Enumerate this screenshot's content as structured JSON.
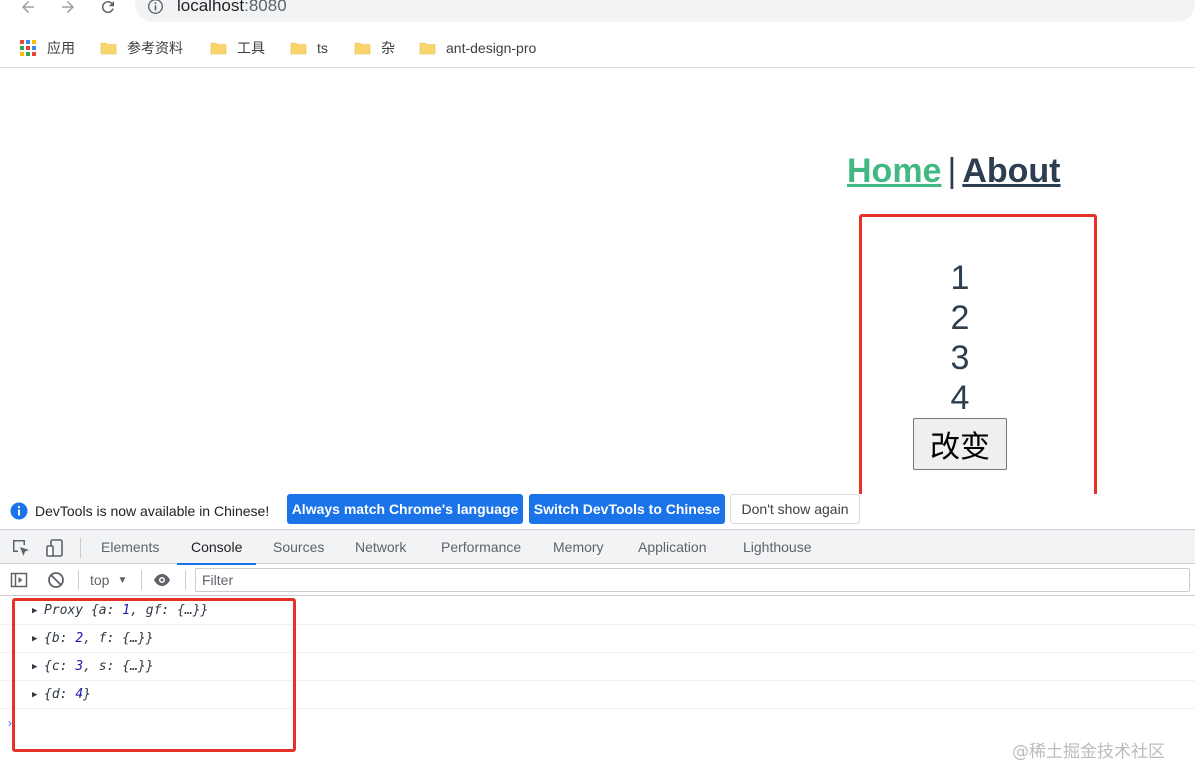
{
  "browser": {
    "url_host": "localhost",
    "url_port": ":8080",
    "bookmarks": [
      {
        "label": "应用"
      },
      {
        "label": "参考资料"
      },
      {
        "label": "工具"
      },
      {
        "label": "ts"
      },
      {
        "label": "杂"
      },
      {
        "label": "ant-design-pro"
      }
    ]
  },
  "page": {
    "nav": {
      "home": "Home",
      "separator": "|",
      "about": "About"
    },
    "numbers": [
      "1",
      "2",
      "3",
      "4"
    ],
    "change_button": "改变"
  },
  "devtools": {
    "infobar": {
      "message": "DevTools is now available in Chinese!",
      "btn_match": "Always match Chrome's language",
      "btn_switch": "Switch DevTools to Chinese",
      "btn_dismiss": "Don't show again"
    },
    "tabs": [
      "Elements",
      "Console",
      "Sources",
      "Network",
      "Performance",
      "Memory",
      "Application",
      "Lighthouse"
    ],
    "active_tab": "Console",
    "console": {
      "context": "top",
      "filter_placeholder": "Filter",
      "lines": [
        {
          "prefix": "Proxy {a: ",
          "num": "1",
          "suffix": ", gf: {…}}"
        },
        {
          "prefix": "{b: ",
          "num": "2",
          "suffix": ", f: {…}}"
        },
        {
          "prefix": "{c: ",
          "num": "3",
          "suffix": ", s: {…}}"
        },
        {
          "prefix": "{d: ",
          "num": "4",
          "suffix": "}"
        }
      ]
    }
  },
  "watermark": "@稀土掘金技术社区",
  "colors": {
    "home_link": "#42b983",
    "about_link": "#2c3e50",
    "highlight_box": "#e8302a",
    "devtools_blue": "#1a73e8"
  }
}
